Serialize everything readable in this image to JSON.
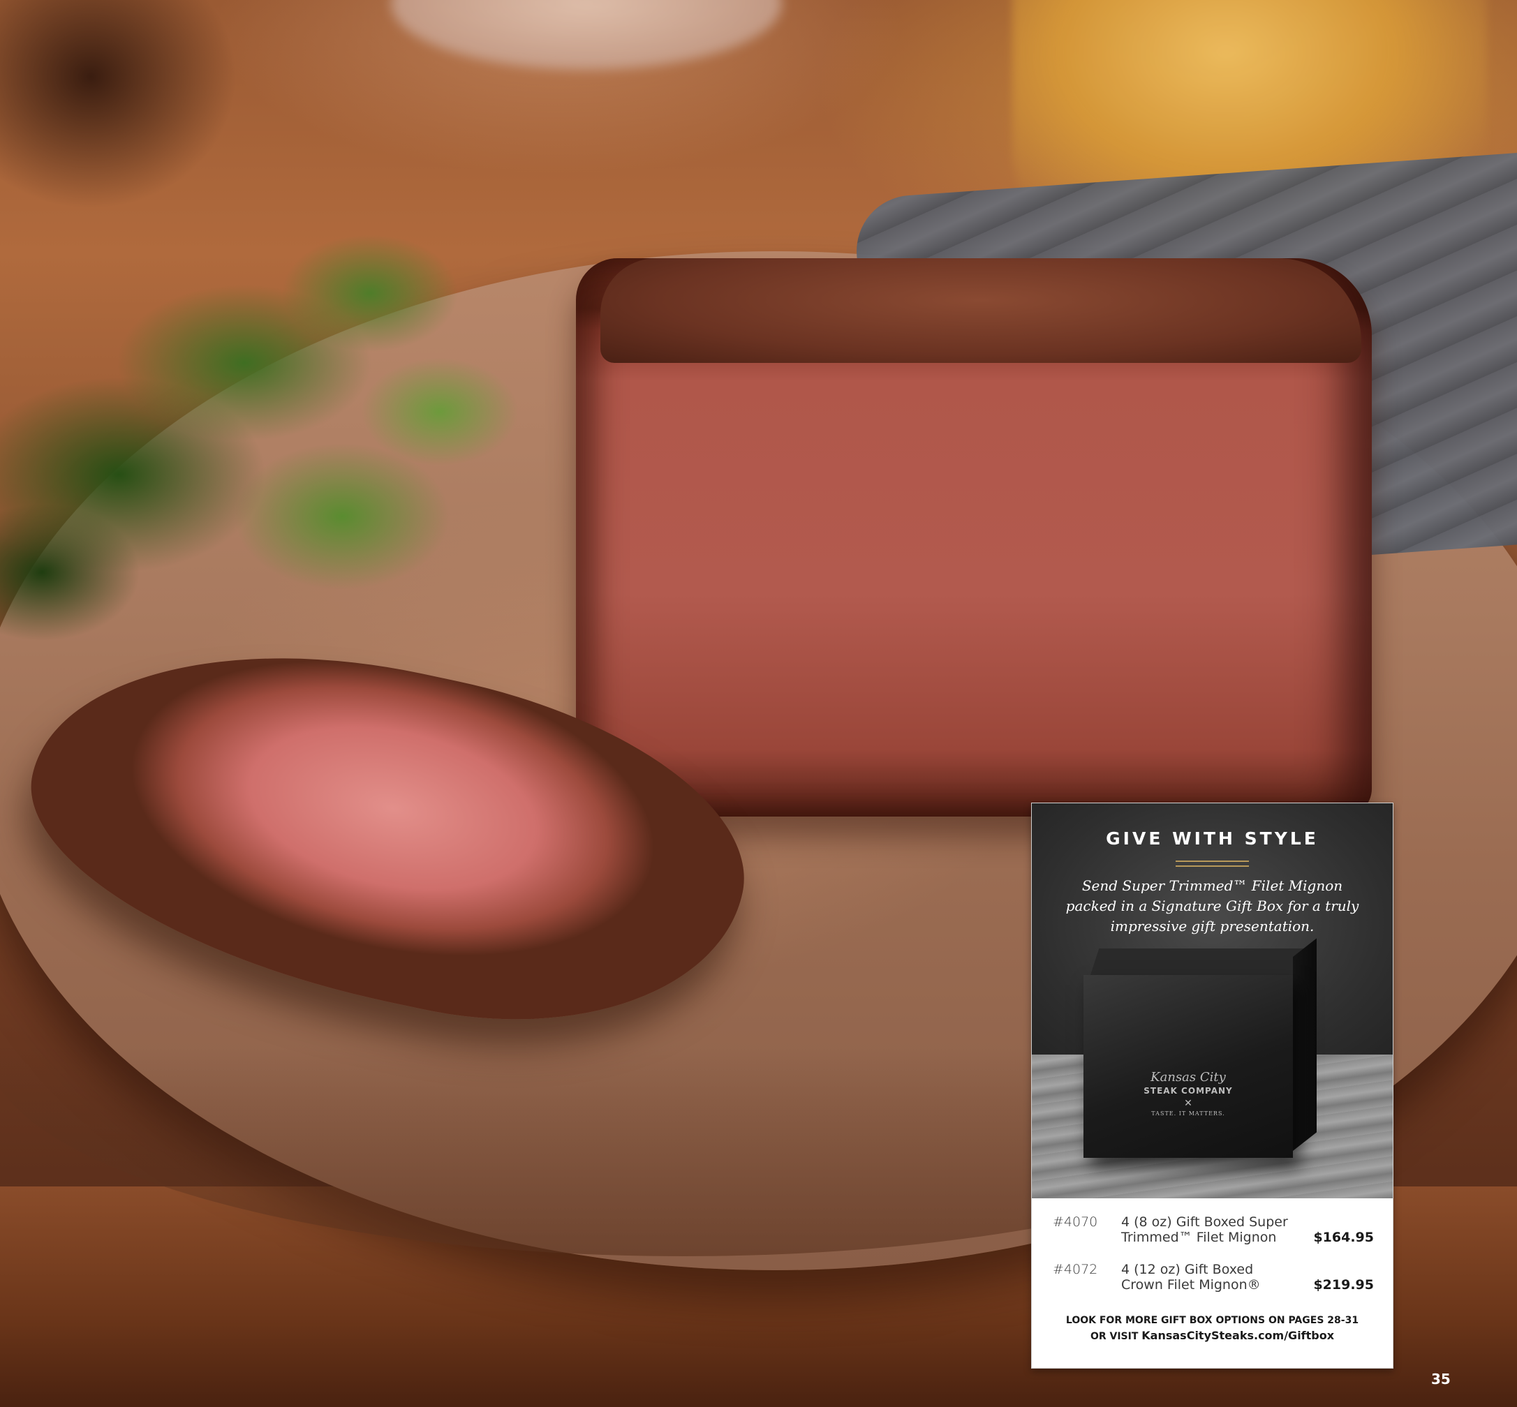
{
  "card": {
    "title": "GIVE WITH STYLE",
    "description": "Send Super Trimmed™ Filet Mignon packed in a Signature Gift Box for a truly impressive gift presentation.",
    "box_logo": {
      "script": "Kansas City",
      "name": "STEAK COMPANY",
      "tagline": "TASTE. IT MATTERS."
    },
    "products": [
      {
        "sku": "#4070",
        "description": "4 (8 oz) Gift Boxed Super Trimmed™ Filet Mignon",
        "price": "$164.95"
      },
      {
        "sku": "#4072",
        "description": "4 (12 oz) Gift Boxed Crown Filet Mignon®",
        "price": "$219.95"
      }
    ],
    "footer_line1": "LOOK FOR MORE GIFT BOX OPTIONS ON PAGES 28-31",
    "footer_line2_prefix": "OR VISIT ",
    "footer_link": "KansasCitySteaks.com/Giftbox"
  },
  "page_number": "35",
  "colors": {
    "card_dark": "#2e2e2e",
    "gold_rule": "#b8995a",
    "steak_red": "#b25a4e"
  }
}
